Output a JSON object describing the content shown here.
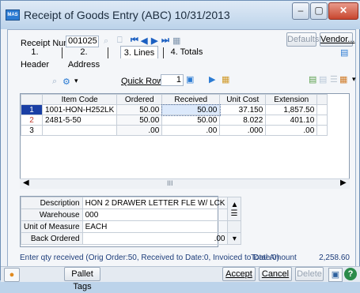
{
  "window": {
    "title": "Receipt of Goods Entry (ABC) 10/31/2013"
  },
  "header": {
    "receipt_label": "Receipt Number",
    "receipt_number": "001025",
    "defaults_button": "Defaults...",
    "vendor_button": "Vendor..."
  },
  "tabs": [
    {
      "label": "1. Header"
    },
    {
      "label": "2. Address"
    },
    {
      "label": "3. Lines"
    },
    {
      "label": "4. Totals"
    }
  ],
  "toolbar": {
    "quick_row_label": "Quick Row",
    "quick_row_value": "1"
  },
  "grid": {
    "columns": [
      "Item Code",
      "Ordered",
      "Received",
      "Unit Cost",
      "Extension"
    ],
    "rows": [
      {
        "num": "1",
        "item": "1001-HON-H252LK",
        "ordered": "50.00",
        "received": "50.00",
        "unit_cost": "37.150",
        "extension": "1,857.50"
      },
      {
        "num": "2",
        "item": "2481-5-50",
        "ordered": "50.00",
        "received": "50.00",
        "unit_cost": "8.022",
        "extension": "401.10"
      },
      {
        "num": "3",
        "item": "",
        "ordered": ".00",
        "received": ".00",
        "unit_cost": ".000",
        "extension": ".00"
      }
    ],
    "scroll_grip": "III"
  },
  "details": {
    "description_label": "Description",
    "description_value": "HON 2 DRAWER LETTER FLE W/ LCK",
    "warehouse_label": "Warehouse",
    "warehouse_value": "000",
    "uom_label": "Unit of Measure",
    "uom_value": "EACH",
    "back_ordered_label": "Back Ordered",
    "back_ordered_value": ".00"
  },
  "status": {
    "message": "Enter qty received (Orig Order:50, Received to Date:0, Invoiced to Date:0)",
    "total_label": "Total Amount",
    "total_value": "2,258.60"
  },
  "bottom": {
    "pallet_tags": "Pallet Tags",
    "accept": "Accept",
    "cancel": "Cancel",
    "delete": "Delete"
  }
}
